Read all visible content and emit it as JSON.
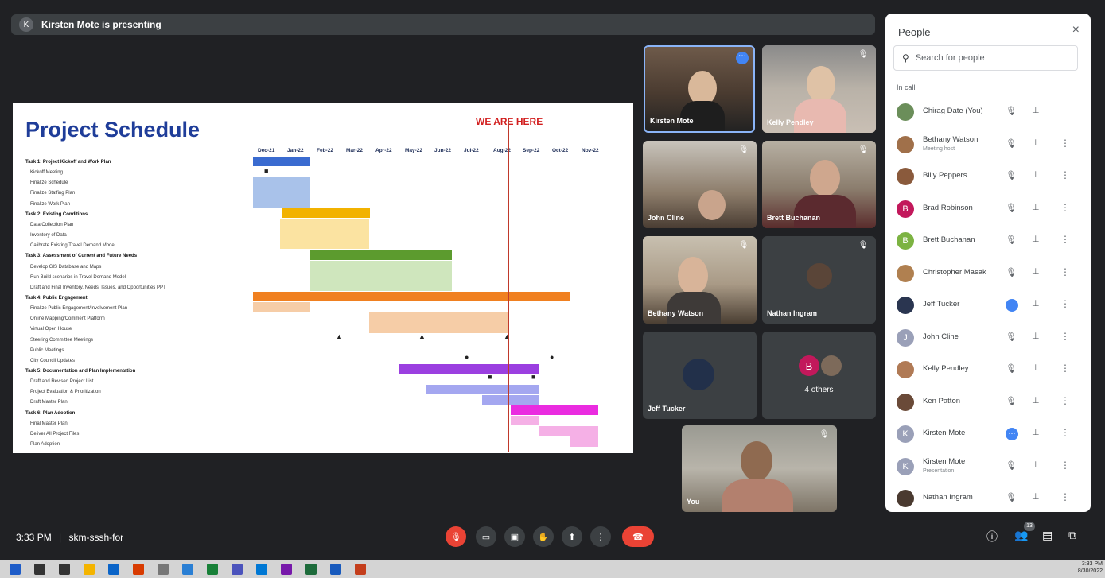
{
  "presenter_bar": {
    "initial": "K",
    "text": "Kirsten Mote is presenting"
  },
  "slide": {
    "title": "Project Schedule",
    "marker": "WE ARE HERE",
    "months": [
      "Dec-21",
      "Jan-22",
      "Feb-22",
      "Mar-22",
      "Apr-22",
      "May-22",
      "Jun-22",
      "Jul-22",
      "Aug-22",
      "Sep-22",
      "Oct-22",
      "Nov-22"
    ],
    "tasks": [
      {
        "t": "Task 1: Project Kickoff and Work Plan",
        "h": true
      },
      {
        "t": "Kickoff Meeting"
      },
      {
        "t": "Finalize Schedule"
      },
      {
        "t": "Finalize Staffing Plan"
      },
      {
        "t": "Finalize Work Plan"
      },
      {
        "t": "Task 2: Existing Conditions",
        "h": true
      },
      {
        "t": "Data Collection Plan"
      },
      {
        "t": "Inventory of Data"
      },
      {
        "t": "Calibrate Existing Travel Demand Model"
      },
      {
        "t": "Task 3: Assessment of Current and Future Needs",
        "h": true
      },
      {
        "t": "Develop GIS Database and Maps"
      },
      {
        "t": "Run Build scenarios in Travel Demand Model"
      },
      {
        "t": "Draft and Final Inventory, Needs, Issues, and Opportunities PPT"
      },
      {
        "t": "Task 4: Public Engagement",
        "h": true
      },
      {
        "t": "Finalize Public Engagement/Involvement Plan"
      },
      {
        "t": "Online Mapping/Comment Platform"
      },
      {
        "t": "Virtual Open House"
      },
      {
        "t": "Steering Committee Meetings"
      },
      {
        "t": "Public Meetings"
      },
      {
        "t": "City Council Updates"
      },
      {
        "t": "Task 5: Documentation and Plan Implementation",
        "h": true
      },
      {
        "t": "Draft and Revised Project List"
      },
      {
        "t": "Project Evaluation & Prioritization"
      },
      {
        "t": "Draft Master Plan"
      },
      {
        "t": "Task 6: Plan Adoption",
        "h": true
      },
      {
        "t": "Final Master Plan"
      },
      {
        "t": "Deliver All Project Files"
      },
      {
        "t": "Plan Adoption"
      }
    ]
  },
  "tiles": {
    "kirsten": "Kirsten Mote",
    "kelly": "Kelly Pendley",
    "john": "John Cline",
    "brett": "Brett Buchanan",
    "bethany": "Bethany Watson",
    "nathan": "Nathan Ingram",
    "jeff": "Jeff Tucker",
    "others": "4 others",
    "others_initial": "B",
    "you": "You"
  },
  "bottom": {
    "time": "3:33 PM",
    "sep": "|",
    "meeting": "skm-sssh-for",
    "people_count": "13"
  },
  "taskbar": {
    "clock": "3:33 PM",
    "date": "8/30/2022"
  },
  "panel": {
    "title": "People",
    "close": "×",
    "search_placeholder": "Search for people",
    "section": "In call",
    "people": [
      {
        "name": "Chirag Date (You)",
        "sub": "",
        "color": "#6b8e5a",
        "initial": ""
      },
      {
        "name": "Bethany Watson",
        "sub": "Meeting host",
        "color": "#a0704a",
        "initial": ""
      },
      {
        "name": "Billy Peppers",
        "sub": "",
        "color": "#8a5a3c",
        "initial": ""
      },
      {
        "name": "Brad Robinson",
        "sub": "",
        "color": "#c2185b",
        "initial": "B"
      },
      {
        "name": "Brett Buchanan",
        "sub": "",
        "color": "#7cb342",
        "initial": "B"
      },
      {
        "name": "Christopher Masak",
        "sub": "",
        "color": "#b08050",
        "initial": ""
      },
      {
        "name": "Jeff Tucker",
        "sub": "",
        "color": "#2a3550",
        "initial": ""
      },
      {
        "name": "John Cline",
        "sub": "",
        "color": "#9aa0b8",
        "initial": "J"
      },
      {
        "name": "Kelly Pendley",
        "sub": "",
        "color": "#b07a55",
        "initial": ""
      },
      {
        "name": "Ken Patton",
        "sub": "",
        "color": "#6a4a38",
        "initial": ""
      },
      {
        "name": "Kirsten Mote",
        "sub": "",
        "color": "#9aa0b8",
        "initial": "K"
      },
      {
        "name": "Kirsten Mote",
        "sub": "Presentation",
        "color": "#9aa0b8",
        "initial": "K"
      },
      {
        "name": "Nathan Ingram",
        "sub": "",
        "color": "#4a3a30",
        "initial": ""
      }
    ]
  }
}
